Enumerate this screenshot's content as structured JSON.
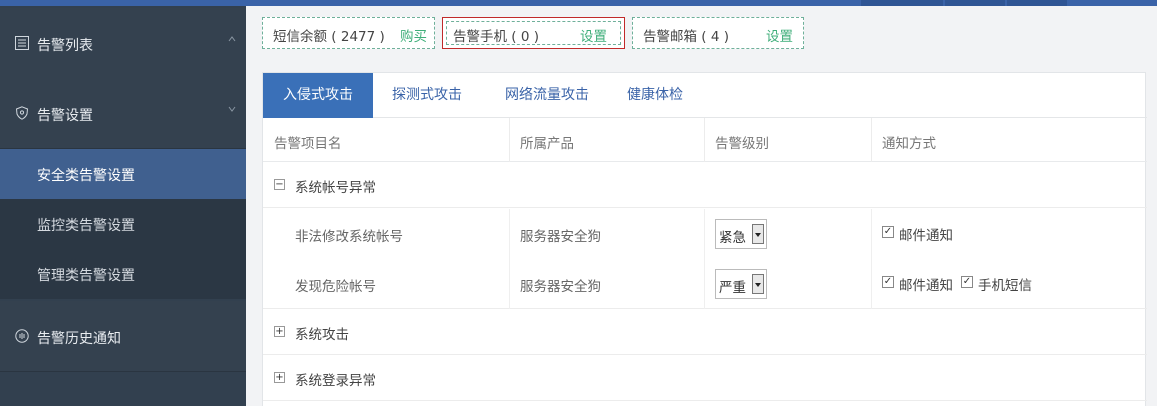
{
  "sidebar": {
    "groups": [
      {
        "label": "告警列表",
        "icon": "list-icon"
      },
      {
        "label": "告警设置",
        "icon": "shield-icon"
      },
      {
        "label": "告警历史通知",
        "icon": "history-icon"
      }
    ],
    "sub_items": [
      {
        "label": "安全类告警设置",
        "active": true
      },
      {
        "label": "监控类告警设置",
        "active": false
      },
      {
        "label": "管理类告警设置",
        "active": false
      }
    ]
  },
  "chips": [
    {
      "text": "短信余额 ( 2477 )",
      "action": "购买"
    },
    {
      "text": "告警手机 ( 0 )",
      "action": "设置"
    },
    {
      "text": "告警邮箱 ( 4 )",
      "action": "设置"
    }
  ],
  "tabs": [
    "入侵式攻击",
    "探测式攻击",
    "网络流量攻击",
    "健康体检"
  ],
  "table": {
    "headers": [
      "告警项目名",
      "所属产品",
      "告警级别",
      "通知方式"
    ],
    "groups": [
      {
        "label": "系统帐号异常",
        "toggle": "−",
        "rows": [
          {
            "name": "非法修改系统帐号",
            "product": "服务器安全狗",
            "level": "紧急",
            "notify": [
              "邮件通知"
            ]
          },
          {
            "name": "发现危险帐号",
            "product": "服务器安全狗",
            "level": "严重",
            "notify": [
              "邮件通知",
              "手机短信"
            ]
          }
        ]
      },
      {
        "label": "系统攻击",
        "toggle": "+"
      },
      {
        "label": "系统登录异常",
        "toggle": "+"
      }
    ]
  },
  "colors": {
    "accent": "#3a70b8",
    "sidebar": "#32404f",
    "active_sub": "#40608f",
    "link_green": "#3fae7a",
    "highlight": "#c12a2a"
  }
}
